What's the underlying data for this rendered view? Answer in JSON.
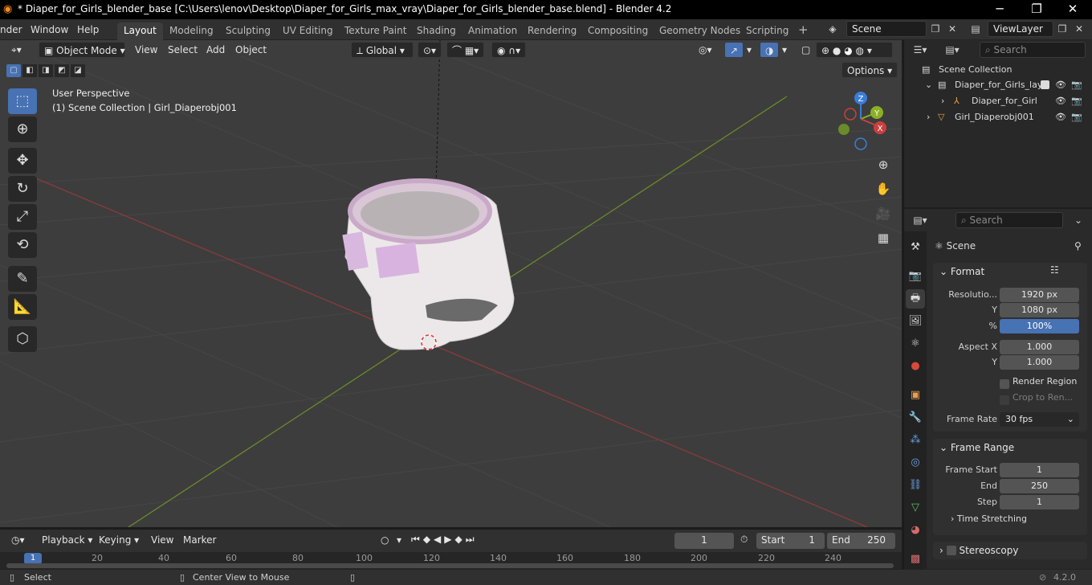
{
  "app": {
    "title": "* Diaper_for_Girls_blender_base [C:\\Users\\lenov\\Desktop\\Diaper_for_Girls_max_vray\\Diaper_for_Girls_blender_base.blend] - Blender 4.2",
    "version": "4.2.0"
  },
  "window_controls": {
    "minimize": "─",
    "maximize": "❐",
    "close": "✕"
  },
  "menu": [
    "nder",
    "Window",
    "Help"
  ],
  "workspaces": [
    {
      "label": "Layout",
      "active": true
    },
    {
      "label": "Modeling"
    },
    {
      "label": "Sculpting"
    },
    {
      "label": "UV Editing"
    },
    {
      "label": "Texture Paint"
    },
    {
      "label": "Shading"
    },
    {
      "label": "Animation"
    },
    {
      "label": "Rendering"
    },
    {
      "label": "Compositing"
    },
    {
      "label": "Geometry Nodes"
    },
    {
      "label": "Scripting"
    }
  ],
  "add_workspace": "+",
  "scene_selector": "Scene",
  "viewlayer_selector": "ViewLayer",
  "viewport": {
    "mode": "Object Mode",
    "menus": [
      "View",
      "Select",
      "Add",
      "Object"
    ],
    "transform_orientation": "Global",
    "options_label": "Options",
    "info_line1": "User Perspective",
    "info_line2": "(1) Scene Collection | Girl_Diaperobj001",
    "gizmo": {
      "z": "Z",
      "y": "Y",
      "x": "X"
    }
  },
  "outliner": {
    "search_placeholder": "Search",
    "scene_collection": "Scene Collection",
    "items": [
      {
        "label": "Diaper_for_Girls_lay"
      },
      {
        "label": "Diaper_for_Girls"
      },
      {
        "label": "Girl_Diaperobj001"
      }
    ]
  },
  "properties": {
    "search_placeholder": "Search",
    "context": "Scene",
    "format": {
      "title": "Format",
      "resolution_label": "Resolutio...",
      "resolution_x": "1920 px",
      "y_label": "Y",
      "resolution_y": "1080 px",
      "percent_label": "%",
      "percent": "100%",
      "aspect_x_label": "Aspect X",
      "aspect_x": "1.000",
      "aspect_y_label": "Y",
      "aspect_y": "1.000",
      "render_region": "Render Region",
      "crop_to_render": "Crop to Ren...",
      "frame_rate_label": "Frame Rate",
      "frame_rate": "30 fps"
    },
    "frame_range": {
      "title": "Frame Range",
      "start_label": "Frame Start",
      "start": "1",
      "end_label": "End",
      "end": "250",
      "step_label": "Step",
      "step": "1",
      "time_stretching": "Time Stretching"
    },
    "stereoscopy": "Stereoscopy"
  },
  "timeline": {
    "menus": [
      "Playback",
      "Keying",
      "View",
      "Marker"
    ],
    "current_frame": "1",
    "start_label": "Start",
    "start": "1",
    "end_label": "End",
    "end": "250",
    "ruler_ticks": [
      "1",
      "20",
      "40",
      "60",
      "80",
      "100",
      "120",
      "140",
      "160",
      "180",
      "200",
      "220",
      "240"
    ]
  },
  "statusbar": {
    "select": "Select",
    "center_view": "Center View to Mouse"
  },
  "colors": {
    "accent": "#4772b3",
    "x_axis": "#c94040",
    "y_axis": "#8cb024",
    "z_axis": "#3b7dd8"
  }
}
